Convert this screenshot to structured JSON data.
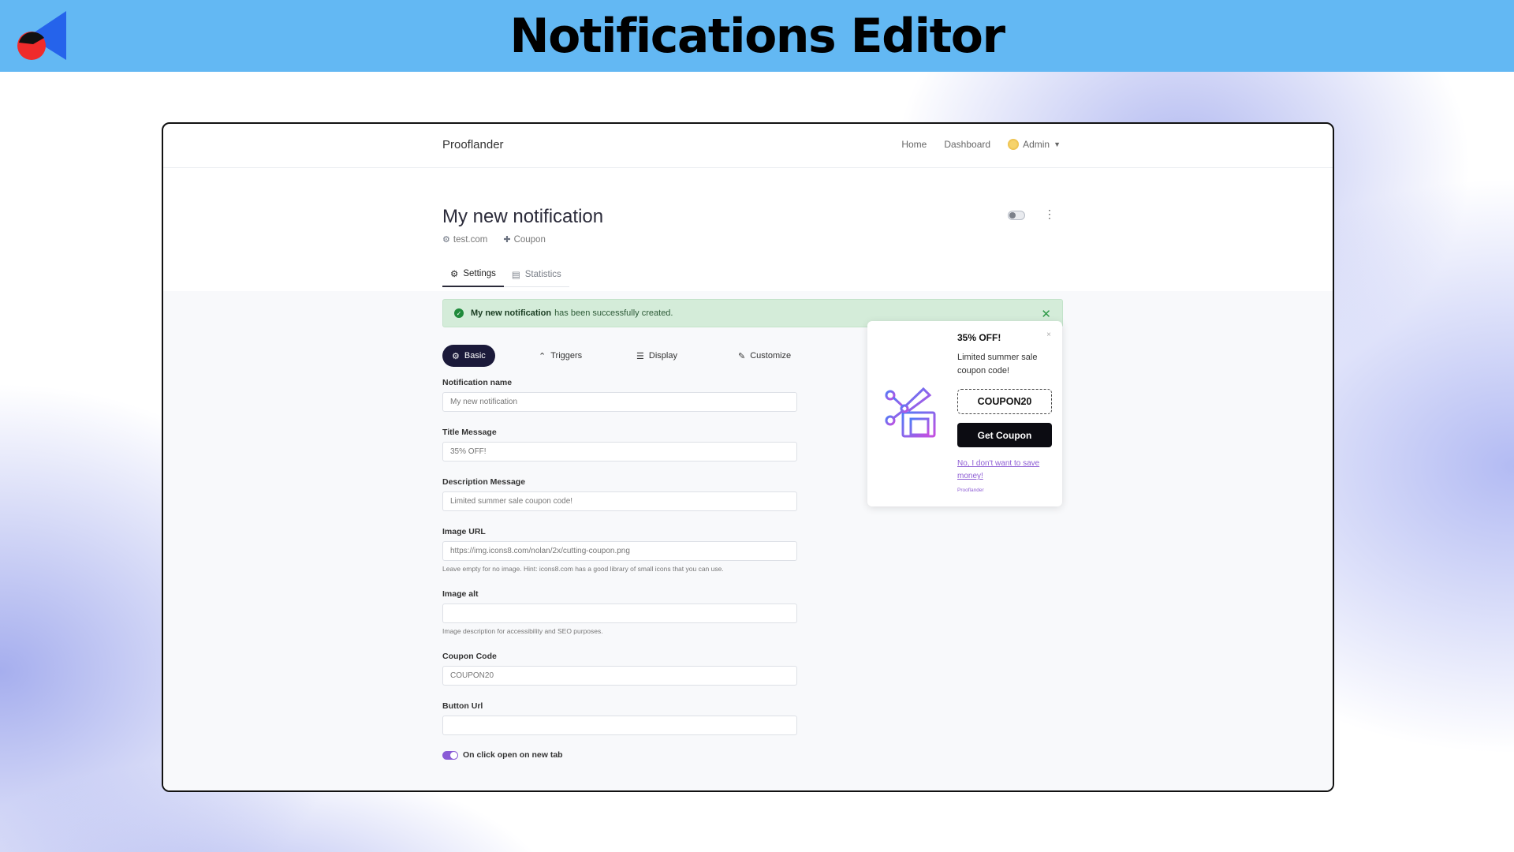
{
  "banner": {
    "title": "Notifications Editor",
    "logo_icon": "brand-logo-icon"
  },
  "navbar": {
    "app_name": "Prooflander",
    "links": [
      "Home",
      "Dashboard"
    ],
    "admin_label": "Admin"
  },
  "header": {
    "title": "My new notification",
    "site": "test.com",
    "type": "Coupon",
    "enabled": false
  },
  "main_tabs": [
    {
      "label": "Settings",
      "icon": "gears-icon",
      "active": true
    },
    {
      "label": "Statistics",
      "icon": "bar-chart-icon",
      "active": false
    }
  ],
  "alert": {
    "bold": "My new notification",
    "text": "has been successfully created."
  },
  "sub_tabs": [
    {
      "label": "Basic",
      "icon": "gear-icon",
      "active": true
    },
    {
      "label": "Triggers",
      "icon": "chevron-up-icon",
      "active": false
    },
    {
      "label": "Display",
      "icon": "sliders-icon",
      "active": false
    },
    {
      "label": "Customize",
      "icon": "brush-icon",
      "active": false
    }
  ],
  "form": {
    "notification_name": {
      "label": "Notification name",
      "value": "My new notification"
    },
    "title_message": {
      "label": "Title Message",
      "value": "35% OFF!"
    },
    "description_message": {
      "label": "Description Message",
      "value": "Limited summer sale coupon code!"
    },
    "image_url": {
      "label": "Image URL",
      "value": "https://img.icons8.com/nolan/2x/cutting-coupon.png",
      "help": "Leave empty for no image. Hint: icons8.com has a good library of small icons that you can use."
    },
    "image_alt": {
      "label": "Image alt",
      "value": "",
      "help": "Image description for accessibility and SEO purposes."
    },
    "coupon_code": {
      "label": "Coupon Code",
      "value": "COUPON20"
    },
    "button_url": {
      "label": "Button Url",
      "value": ""
    },
    "new_tab": {
      "label": "On click open on new tab",
      "on": true
    }
  },
  "preview": {
    "title": "35% OFF!",
    "description": "Limited summer sale coupon code!",
    "coupon": "COUPON20",
    "button": "Get Coupon",
    "decline": "No, I don't want to save money!",
    "brand": "Prooflander",
    "image_icon": "cutting-coupon-icon",
    "close": "×"
  },
  "colors": {
    "banner": "#63b8f3",
    "accent": "#1b1a3a",
    "success_bg": "#d4ecd9",
    "link_purple": "#8e5ed4"
  }
}
